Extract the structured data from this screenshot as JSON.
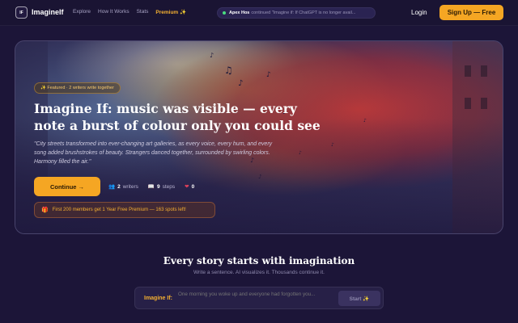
{
  "nav": {
    "logo_initials": "IF",
    "brand": "ImagineIf",
    "links": [
      "Explore",
      "How It Works",
      "Stats"
    ],
    "premium": "Premium ✨",
    "ticker_name": "Apex Hos",
    "ticker_text": "continued \"Imagine if: If ChatGPT is no longer avail...",
    "login": "Login",
    "signup": "Sign Up — Free"
  },
  "hero": {
    "featured_badge": "✨ Featured · 2 writers write together",
    "title": "Imagine If: music was visible — every note a burst of colour only you could see",
    "subtitle": "\"City streets transformed into ever-changing art galleries, as every voice, every hum, and every song added brushstrokes of beauty. Strangers danced together, surrounded by swirling colors. Harmony filled the air.\"",
    "continue_label": "Continue →",
    "stats": {
      "writers_count": "2",
      "writers_label": "writers",
      "steps_count": "9",
      "steps_label": "steps",
      "likes_count": "0"
    },
    "promo_text": "First 200 members get 1 Year Free Premium — 163 spots left!"
  },
  "section": {
    "title": "Every story starts with imagination",
    "subtitle": "Write a sentence. AI visualizes it. Thousands continue it."
  },
  "composer": {
    "label": "Imagine If:",
    "placeholder": "One morning you woke up and everyone had forgotten you...",
    "start_label": "Start ✨"
  },
  "colors": {
    "background": "#1c1538",
    "accent": "#f5a623",
    "premium": "#f5b031"
  }
}
